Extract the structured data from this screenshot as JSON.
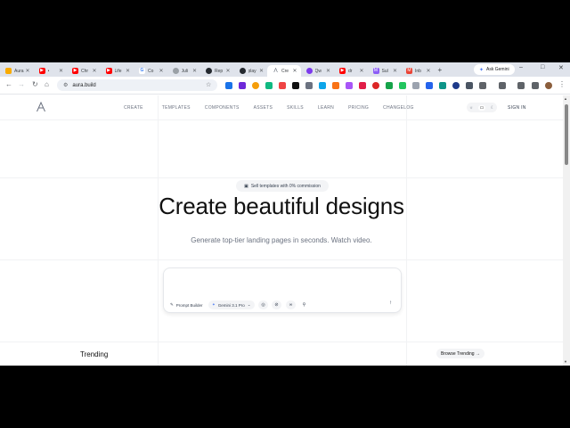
{
  "browser": {
    "tabs": [
      {
        "title": "Aura",
        "favicon": "chart-icon",
        "color": "#f9ab00",
        "active": false
      },
      {
        "title": "•",
        "favicon": "youtube-icon",
        "color": "#ff0000",
        "active": false
      },
      {
        "title": "Chr",
        "favicon": "youtube-icon",
        "color": "#ff0000",
        "active": false
      },
      {
        "title": "Life",
        "favicon": "youtube-icon",
        "color": "#ff0000",
        "active": false
      },
      {
        "title": "Co",
        "favicon": "google-icon",
        "color": "#4285f4",
        "active": false
      },
      {
        "title": "Juli",
        "favicon": "globe-icon",
        "color": "#9aa0a6",
        "active": false
      },
      {
        "title": "Rep",
        "favicon": "github-icon",
        "color": "#24292f",
        "active": false
      },
      {
        "title": "play",
        "favicon": "github-icon",
        "color": "#24292f",
        "active": false
      },
      {
        "title": "Cre",
        "favicon": "aura-icon",
        "color": "#6b7280",
        "active": true
      },
      {
        "title": "Qw",
        "favicon": "qwen-icon",
        "color": "#7c3aed",
        "active": false
      },
      {
        "title": "dr",
        "favicon": "youtube-icon",
        "color": "#ff0000",
        "active": false
      },
      {
        "title": "Sul",
        "favicon": "m-icon",
        "color": "#8b5cf6",
        "active": false
      },
      {
        "title": "Inb",
        "favicon": "gmail-icon",
        "color": "#ea4335",
        "active": false
      }
    ],
    "new_tab_label": "+",
    "ask_gemini_label": "Ask Gemini",
    "url": "aura.build",
    "window_controls": {
      "minimize": "–",
      "maximize": "□",
      "close": "✕"
    }
  },
  "site": {
    "nav_items": [
      "CREATE",
      "TEMPLATES",
      "COMPONENTS",
      "ASSETS",
      "SKILLS",
      "LEARN",
      "PRICING",
      "CHANGELOG"
    ],
    "sign_in": "SIGN IN",
    "badge_text": "Sell templates with 0% commission",
    "hero_title": "Create beautiful designs",
    "hero_subtitle": "Generate top-tier landing pages in seconds.  Watch video.",
    "prompt": {
      "placeholder": "",
      "value": "",
      "builder_label": "Prompt Builder",
      "model_label": "Gemini 3.1 Pro",
      "model_chevron": "⌄"
    },
    "trending_label": "Trending",
    "browse_label": "Browse Trending →"
  },
  "colors": {
    "tabstrip": "#dfe3eb",
    "page_bg": "#ffffff",
    "title": "#111111",
    "muted": "#6b7280"
  }
}
